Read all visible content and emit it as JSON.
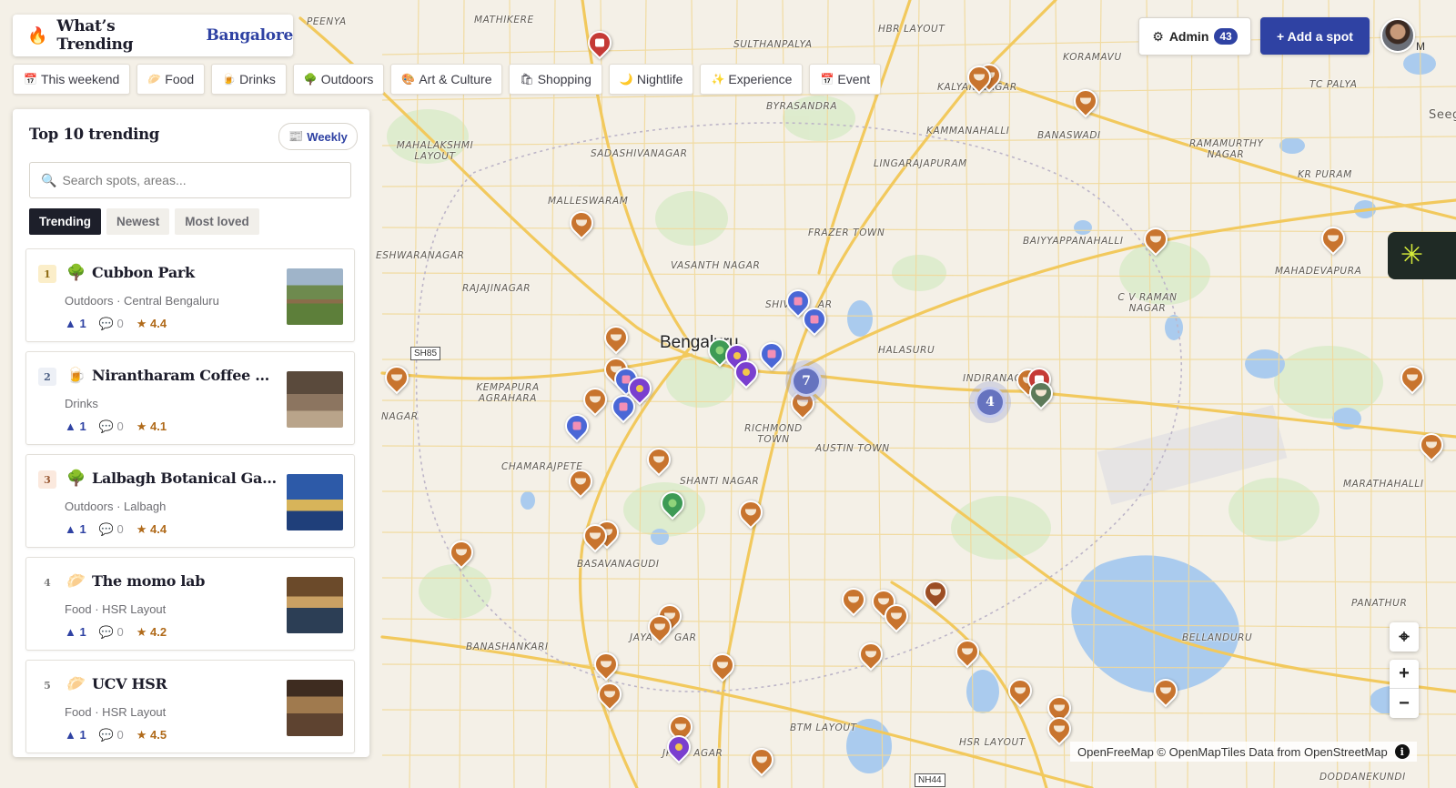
{
  "header": {
    "brand_icon": "flame-icon",
    "title": "What’s Trending",
    "city": "Bangalore"
  },
  "chips": [
    {
      "icon": "📅",
      "label": "This weekend"
    },
    {
      "icon": "🥟",
      "label": "Food"
    },
    {
      "icon": "🍺",
      "label": "Drinks"
    },
    {
      "icon": "🌳",
      "label": "Outdoors"
    },
    {
      "icon": "🎨",
      "label": "Art & Culture"
    },
    {
      "icon": "🛍",
      "label": "Shopping"
    },
    {
      "icon": "🌙",
      "label": "Nightlife"
    },
    {
      "icon": "✨",
      "label": "Experience"
    },
    {
      "icon": "📅",
      "label": "Event"
    }
  ],
  "top_right": {
    "admin_label": "Admin",
    "admin_icon": "⚙",
    "admin_count": "43",
    "add_spot_label": "+ Add a spot",
    "avatar_letter": "M"
  },
  "panel": {
    "title": "Top 10 trending",
    "period_icon": "📰",
    "period_label": "Weekly",
    "search_placeholder": "Search spots, areas...",
    "tabs": [
      "Trending",
      "Newest",
      "Most loved"
    ],
    "active_tab": "Trending"
  },
  "spots": [
    {
      "rank": "1",
      "icon": "🌳",
      "name": "Cubbon Park",
      "meta": "Outdoors · Central Bengaluru",
      "upvotes": "1",
      "comments": "0",
      "rating": "4.4"
    },
    {
      "rank": "2",
      "icon": "🍺",
      "name": "Nirantharam Coffee House",
      "meta": "Drinks",
      "upvotes": "1",
      "comments": "0",
      "rating": "4.1"
    },
    {
      "rank": "3",
      "icon": "🌳",
      "name": "Lalbagh Botanical Garden",
      "meta": "Outdoors · Lalbagh",
      "upvotes": "1",
      "comments": "0",
      "rating": "4.4"
    },
    {
      "rank": "4",
      "icon": "🥟",
      "name": "The momo lab",
      "meta": "Food · HSR Layout",
      "upvotes": "1",
      "comments": "0",
      "rating": "4.2"
    },
    {
      "rank": "5",
      "icon": "🥟",
      "name": "UCV HSR",
      "meta": "Food · HSR Layout",
      "upvotes": "1",
      "comments": "0",
      "rating": "4.5"
    }
  ],
  "map": {
    "city_label": "Bengaluru",
    "area_labels": [
      "PEENYA",
      "MATHIKERE",
      "SULTHANPALYA",
      "HBR LAYOUT",
      "KOramavu",
      "TC PALYA",
      "KALYAN NAGAR",
      "BYRASANDRA",
      "KAMMANAHALLI",
      "BANASWADI",
      "RAMAMURTHY NAGAR",
      "MAHALAKSHMI LAYOUT",
      "SADASHIVANAGAR",
      "LINGARAJAPURAM",
      "KR PURAM",
      "MALLESWARAM",
      "FRAZER TOWN",
      "BAIYYAPPANAHALLI",
      "MAHADEVAPURA",
      "RAJESHWARANAGAR",
      "VASANTH NAGAR",
      "RAJAJINAGAR",
      "SHIVAJINAGAR",
      "C V RAMAN NAGAR",
      "HALASURU",
      "KEMPAPURA AGRAHARA",
      "INDIRANAGAR",
      "RICHMOND TOWN",
      "AUSTIN TOWN",
      "CHAMARAJPET",
      "SHANTI NAGAR",
      "MARATHAHALLI",
      "BASAVANAGUDI",
      "PANATHUR",
      "BELLANDURU",
      "BANASHANKARI",
      "JAYANAGAR",
      "BTM LAYOUT",
      "HSR LAYOUT",
      "JP NAGAR",
      "DODDANEKUNDI",
      "NAGAR"
    ],
    "road_shields": [
      "SH85",
      "NH44"
    ],
    "clusters": [
      "7",
      "4"
    ],
    "attribution": "OpenFreeMap © OpenMapTiles Data from OpenStreetMap",
    "colors": {
      "food": "#c8742e",
      "shopping": "#4a67d6",
      "outdoors": "#3d9a55",
      "art": "#7a3fcf",
      "event": "#c53a36",
      "cluster": "#6673bf",
      "accent": "#2f42a3"
    }
  }
}
